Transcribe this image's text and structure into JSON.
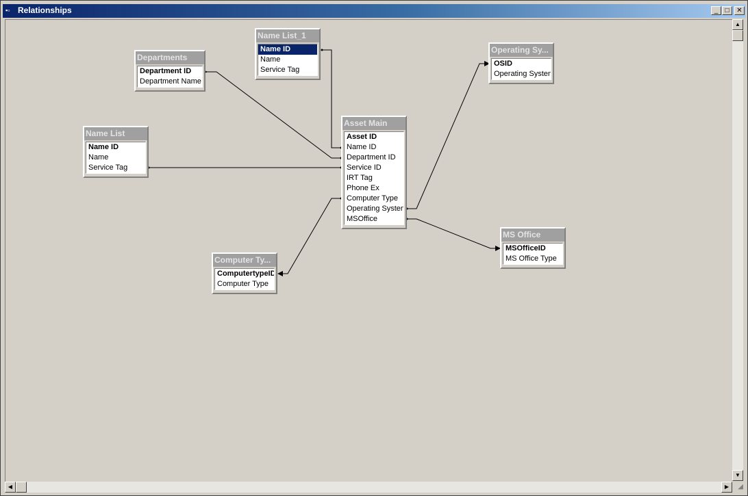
{
  "window": {
    "title": "Relationships"
  },
  "tables": {
    "name_list_1": {
      "title": "Name List_1",
      "fields": [
        "Name ID",
        "Name",
        "Service Tag"
      ]
    },
    "departments": {
      "title": "Departments",
      "fields": [
        "Department ID",
        "Department Name"
      ]
    },
    "operating_systems": {
      "title": "Operating Sy...",
      "fields": [
        "OSID",
        "Operating Systen"
      ]
    },
    "name_list": {
      "title": "Name List",
      "fields": [
        "Name ID",
        "Name",
        "Service Tag"
      ]
    },
    "asset_main": {
      "title": "Asset Main",
      "fields": [
        "Asset ID",
        "Name ID",
        "Department ID",
        "Service ID",
        "IRT Tag",
        "Phone Ex",
        "Computer Type",
        "Operating Systen",
        "MSOffice"
      ]
    },
    "ms_office": {
      "title": "MS Office",
      "fields": [
        "MSOfficeID",
        "MS Office Type"
      ]
    },
    "computer_type": {
      "title": "Computer Ty...",
      "fields": [
        "ComputertypeID",
        "Computer Type"
      ]
    }
  },
  "colors": {
    "title_bar_start": "#0a246a",
    "title_bar_end": "#a6caf0",
    "selected_field": "#0a246a",
    "canvas": "#d4d0c8"
  }
}
